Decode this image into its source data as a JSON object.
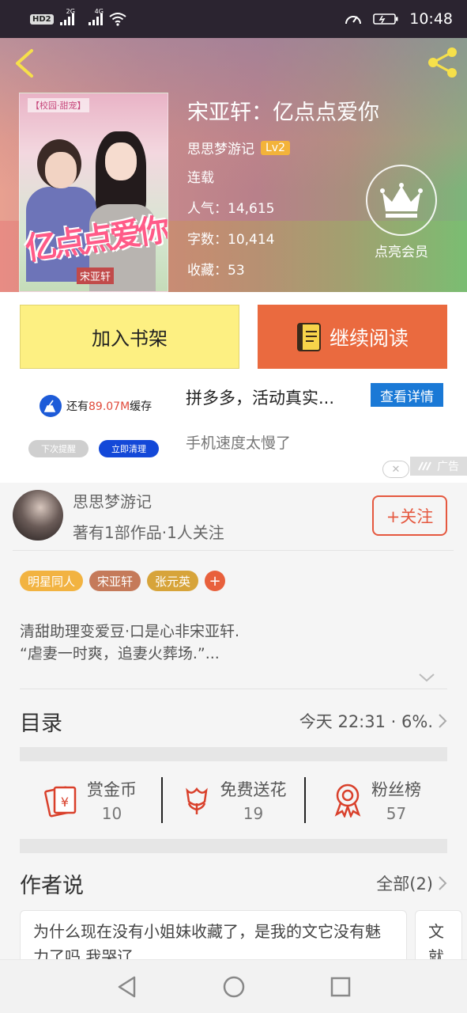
{
  "status_bar": {
    "network1": "2G",
    "network2": "4G",
    "hd": "HD",
    "hd_sub": "2",
    "time": "10:48"
  },
  "book": {
    "title": "宋亚轩：亿点点爱你",
    "author": "思思梦游记",
    "level": "Lv2",
    "status": "连载",
    "popularity_label": "人气：",
    "popularity": "14,615",
    "words_label": "字数：",
    "words": "10,414",
    "favorites_label": "收藏：",
    "favorites": "53",
    "cover_title": "亿点点爱你",
    "cover_tag": "【校园·甜宠】",
    "cover_author": "宋亚轩"
  },
  "vip": {
    "label": "点亮会员"
  },
  "actions": {
    "add_shelf": "加入书架",
    "continue_read": "继续阅读"
  },
  "ad": {
    "cache_prefix": "还有",
    "cache_value": "89.07M",
    "cache_suffix": "缓存",
    "later": "下次提醒",
    "clean_now": "立即清理",
    "title": "拼多多，活动真实...",
    "detail_button": "查看详情",
    "subtitle": "手机速度太慢了",
    "tag": "广告"
  },
  "author_card": {
    "name": "思思梦游记",
    "summary": "著有1部作品·1人关注",
    "follow": "+关注"
  },
  "tags": [
    {
      "label": "明星同人",
      "color": "#f2b341"
    },
    {
      "label": "宋亚轩",
      "color": "#c57a5a"
    },
    {
      "label": "张元英",
      "color": "#d7a43a"
    },
    {
      "label": "+",
      "color": "#e8603c"
    }
  ],
  "synopsis": {
    "line1": "清甜助理变爱豆·口是心非宋亚轩.",
    "line2": "“虐妻一时爽，追妻火葬场.”..."
  },
  "toc": {
    "title": "目录",
    "info": "今天 22:31 · 6%."
  },
  "stats": [
    {
      "label": "赏金币",
      "value": "10"
    },
    {
      "label": "免费送花",
      "value": "19"
    },
    {
      "label": "粉丝榜",
      "value": "57"
    }
  ],
  "author_says": {
    "title": "作者说",
    "all": "全部(2)",
    "comment1": "为什么现在没有小姐妹收藏了，是我的文它没有魅力了吗 我哭辽",
    "comment2": "文就"
  },
  "colors": {
    "accent_orange": "#ea6a3f",
    "shelf_yellow": "#fdf082",
    "follow_red": "#e5583f",
    "ad_blue": "#1a79d6"
  }
}
